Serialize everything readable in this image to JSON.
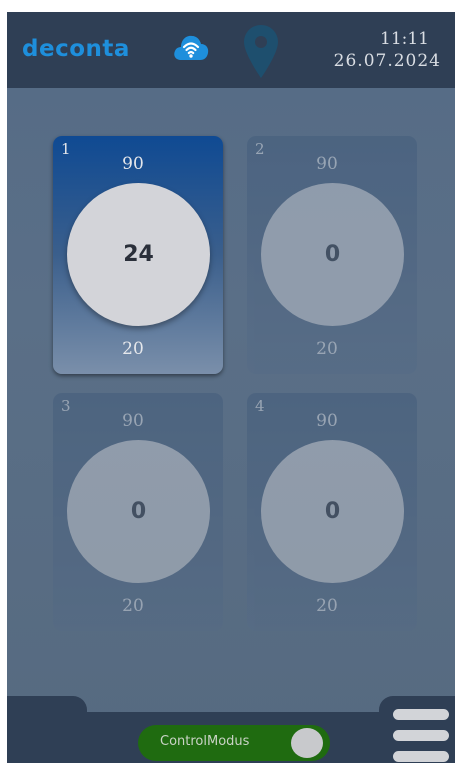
{
  "header": {
    "logo": "deconta",
    "time": "11:11",
    "date": "26.07.2024",
    "icons": [
      "wifi-cloud-icon",
      "location-pin-icon"
    ]
  },
  "zones": [
    {
      "number": "1",
      "max": "90",
      "value": "24",
      "min": "20",
      "active": true
    },
    {
      "number": "2",
      "max": "90",
      "value": "0",
      "min": "20",
      "active": false
    },
    {
      "number": "3",
      "max": "90",
      "value": "0",
      "min": "20",
      "active": false
    },
    {
      "number": "4",
      "max": "90",
      "value": "0",
      "min": "20",
      "active": false
    }
  ],
  "footer": {
    "toggle_label": "ControlModus",
    "toggle_on": true,
    "menu_icon": "hamburger-menu-icon"
  },
  "colors": {
    "header_bg": "#2f3f55",
    "logo": "#1e8fdc",
    "toggle_on": "#1f6b10",
    "active_card_top": "#0f4a93"
  }
}
